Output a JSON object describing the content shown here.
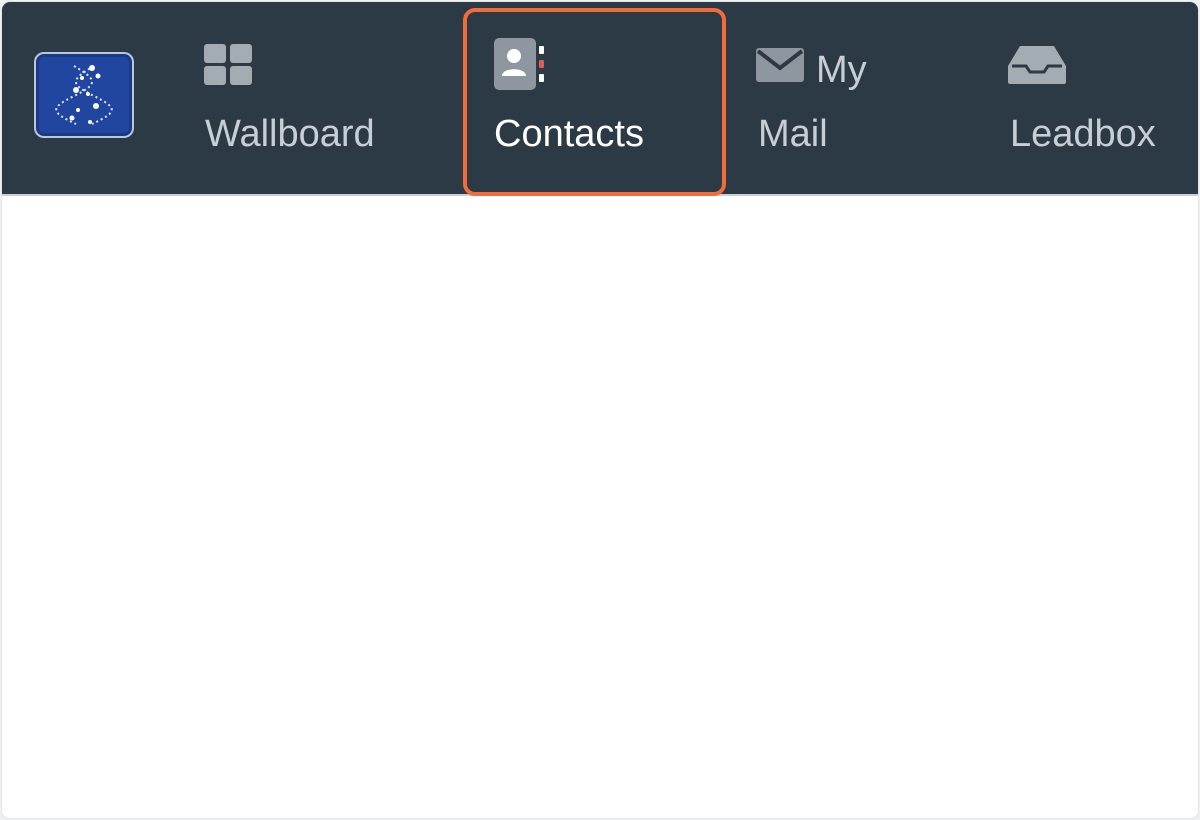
{
  "navbar": {
    "logo_icon": "dna-logo-icon",
    "items": [
      {
        "label": "Wallboard",
        "icon": "grid-icon",
        "active": false
      },
      {
        "label": "Contacts",
        "icon": "address-book-icon",
        "active": true
      },
      {
        "label_line1": "My",
        "label_line2": "Mail",
        "icon": "envelope-icon",
        "active": false
      },
      {
        "label": "Leadbox",
        "icon": "inbox-tray-icon",
        "active": false
      }
    ]
  },
  "colors": {
    "navbar_bg": "#2b3a45",
    "highlight": "#f26b3a",
    "logo_bg": "#2146a0",
    "icon_gray": "#9aa3ab"
  }
}
